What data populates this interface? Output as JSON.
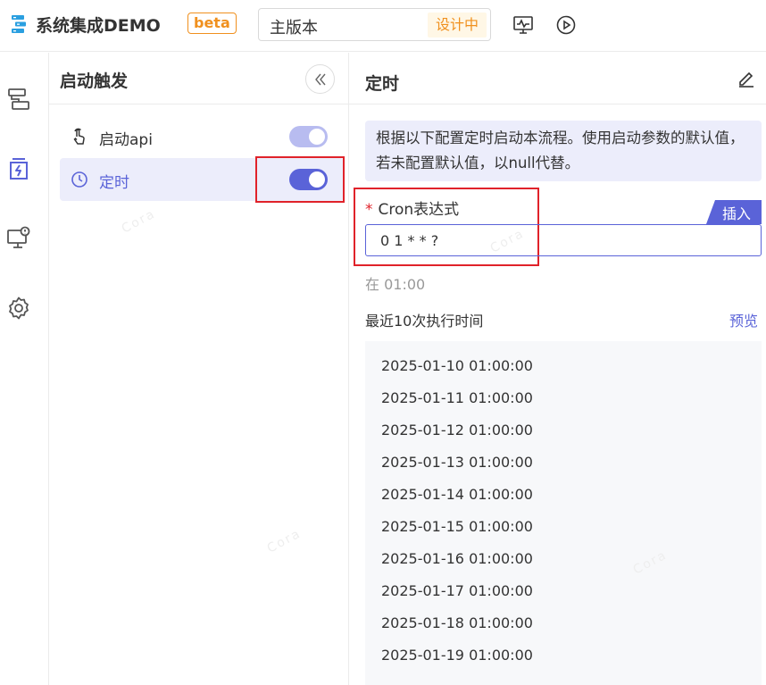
{
  "app": {
    "title": "系统集成DEMO",
    "beta_label": "beta",
    "version_name": "主版本",
    "version_status": "设计中",
    "accent_color": "#5a63d8",
    "warning_color": "#f0901e"
  },
  "header_icons": [
    "monitor-chart-icon",
    "play-circle-icon"
  ],
  "rail": {
    "items": [
      "flow-layout-icon",
      "trigger-lightning-icon",
      "monitor-alert-icon",
      "settings-gear-icon"
    ],
    "active": "trigger-lightning-icon"
  },
  "trigger_panel": {
    "title": "启动触发",
    "items": [
      {
        "label": "启动api",
        "icon": "hand-pointer-icon",
        "enabled": true,
        "switch_disabled": true
      },
      {
        "label": "定时",
        "icon": "clock-icon",
        "enabled": true,
        "selected": true
      }
    ]
  },
  "detail": {
    "title": "定时",
    "info_text": "根据以下配置定时启动本流程。使用启动参数的默认值，若未配置默认值，以null代替。",
    "cron_label": "Cron表达式",
    "required_mark": "*",
    "insert_label": "插入",
    "cron_value": "0 1 * * ?",
    "cron_description": "在 01:00",
    "recent_label": "最近10次执行时间",
    "preview_label": "预览",
    "recent_times": [
      "2025-01-10 01:00:00",
      "2025-01-11 01:00:00",
      "2025-01-12 01:00:00",
      "2025-01-13 01:00:00",
      "2025-01-14 01:00:00",
      "2025-01-15 01:00:00",
      "2025-01-16 01:00:00",
      "2025-01-17 01:00:00",
      "2025-01-18 01:00:00",
      "2025-01-19 01:00:00"
    ]
  },
  "watermark": "Cora"
}
